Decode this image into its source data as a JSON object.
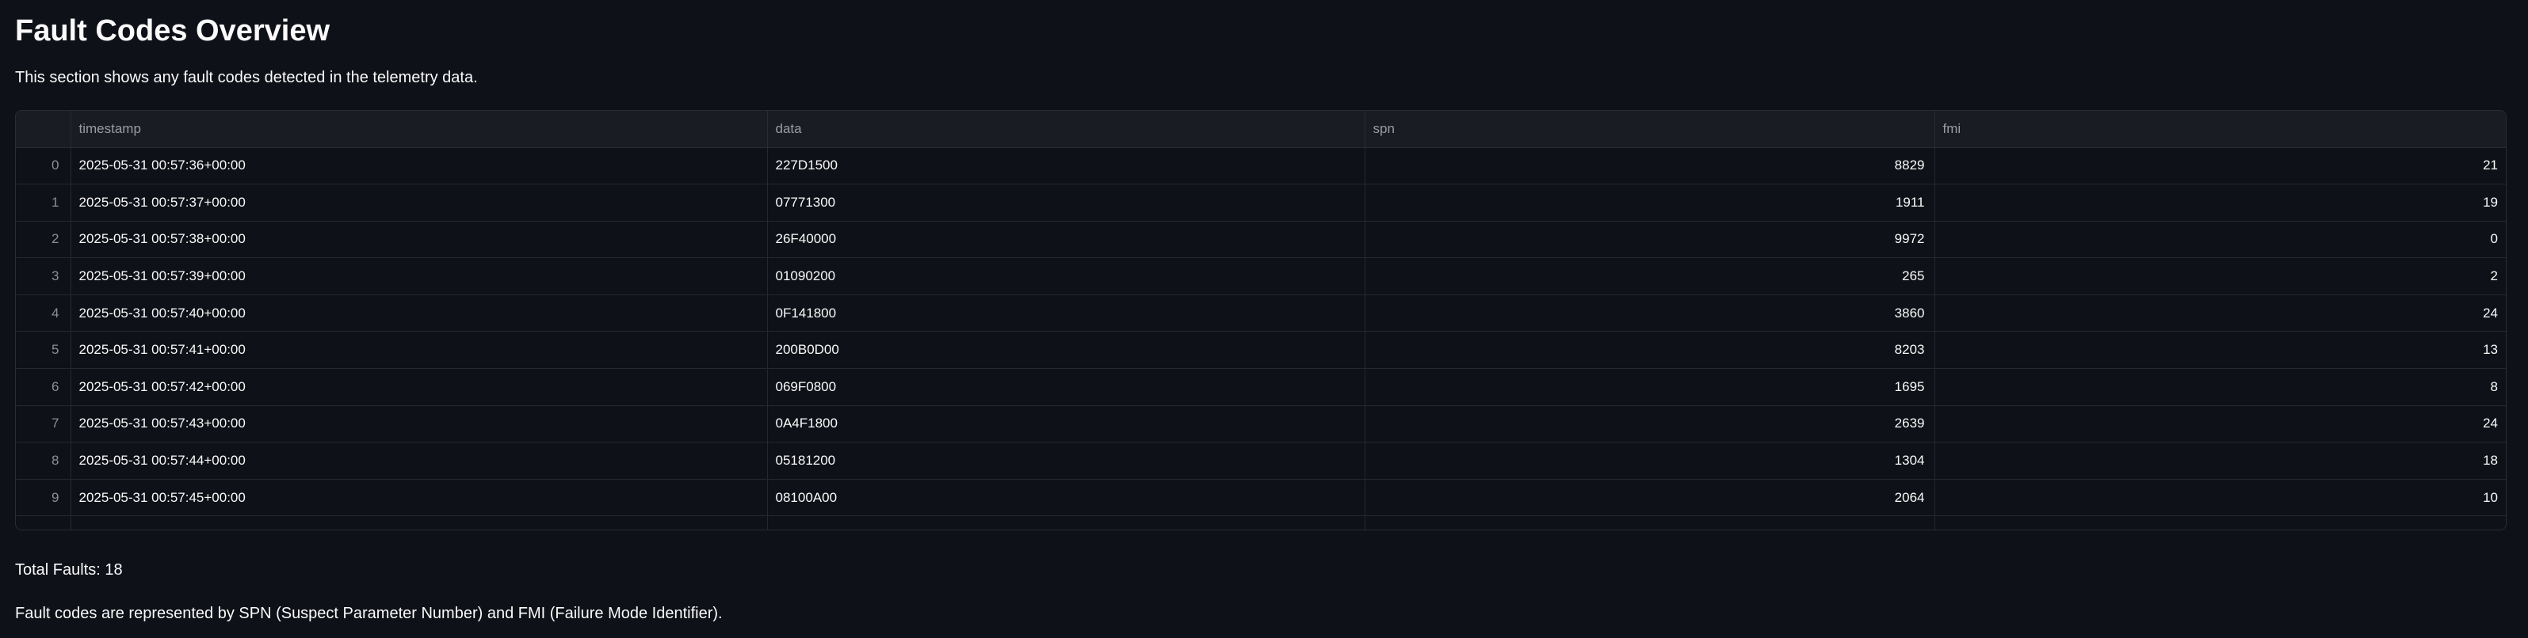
{
  "page": {
    "title": "Fault Codes Overview",
    "description": "This section shows any fault codes detected in the telemetry data.",
    "total_label": "Total Faults: 18",
    "footnote": "Fault codes are represented by SPN (Suspect Parameter Number) and FMI (Failure Mode Identifier)."
  },
  "table": {
    "columns": [
      "",
      "timestamp",
      "data",
      "spn",
      "fmi"
    ],
    "rows": [
      {
        "index": "0",
        "timestamp": "2025-05-31 00:57:36+00:00",
        "data": "227D1500",
        "spn": "8829",
        "fmi": "21"
      },
      {
        "index": "1",
        "timestamp": "2025-05-31 00:57:37+00:00",
        "data": "07771300",
        "spn": "1911",
        "fmi": "19"
      },
      {
        "index": "2",
        "timestamp": "2025-05-31 00:57:38+00:00",
        "data": "26F40000",
        "spn": "9972",
        "fmi": "0"
      },
      {
        "index": "3",
        "timestamp": "2025-05-31 00:57:39+00:00",
        "data": "01090200",
        "spn": "265",
        "fmi": "2"
      },
      {
        "index": "4",
        "timestamp": "2025-05-31 00:57:40+00:00",
        "data": "0F141800",
        "spn": "3860",
        "fmi": "24"
      },
      {
        "index": "5",
        "timestamp": "2025-05-31 00:57:41+00:00",
        "data": "200B0D00",
        "spn": "8203",
        "fmi": "13"
      },
      {
        "index": "6",
        "timestamp": "2025-05-31 00:57:42+00:00",
        "data": "069F0800",
        "spn": "1695",
        "fmi": "8"
      },
      {
        "index": "7",
        "timestamp": "2025-05-31 00:57:43+00:00",
        "data": "0A4F1800",
        "spn": "2639",
        "fmi": "24"
      },
      {
        "index": "8",
        "timestamp": "2025-05-31 00:57:44+00:00",
        "data": "05181200",
        "spn": "1304",
        "fmi": "18"
      },
      {
        "index": "9",
        "timestamp": "2025-05-31 00:57:45+00:00",
        "data": "08100A00",
        "spn": "2064",
        "fmi": "10"
      },
      {
        "index": "",
        "timestamp": "",
        "data": "",
        "spn": "",
        "fmi": ""
      }
    ]
  }
}
